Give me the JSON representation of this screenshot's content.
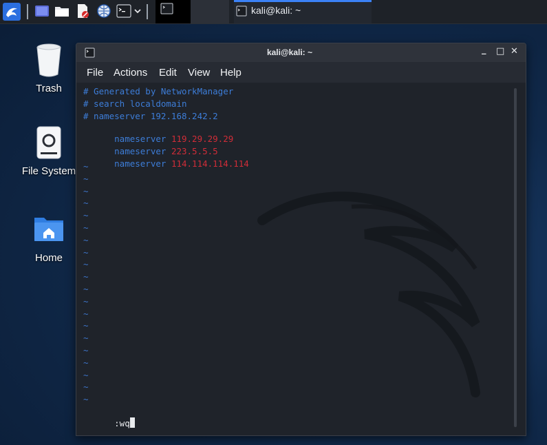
{
  "taskbar": {
    "task_title": "kali@kali: ~",
    "accent_color": "#3b82f6",
    "icons": [
      "kali-menu-icon",
      "show-desktop-icon",
      "file-manager-icon",
      "text-editor-icon",
      "web-browser-icon",
      "terminal-icon",
      "chevron-down-icon",
      "terminal-window-icon"
    ]
  },
  "desktop": {
    "items": [
      {
        "label": "Trash",
        "icon": "trash-icon"
      },
      {
        "label": "File System",
        "icon": "drive-icon"
      },
      {
        "label": "Home",
        "icon": "home-folder-icon"
      }
    ]
  },
  "window": {
    "title": "kali@kali: ~",
    "controls": {
      "minimize": "_",
      "maximize": "□",
      "close": "✕"
    },
    "menu": [
      "File",
      "Actions",
      "Edit",
      "View",
      "Help"
    ]
  },
  "terminal": {
    "comments": [
      "# Generated by NetworkManager",
      "# search localdomain",
      "# nameserver 192.168.242.2"
    ],
    "nameservers": [
      {
        "keyword": "nameserver",
        "value": "119.29.29.29"
      },
      {
        "keyword": "nameserver",
        "value": "223.5.5.5"
      },
      {
        "keyword": "nameserver",
        "value": "114.114.114.114"
      }
    ],
    "tilde": "~",
    "tilde_count": 20,
    "command": ":wq"
  }
}
